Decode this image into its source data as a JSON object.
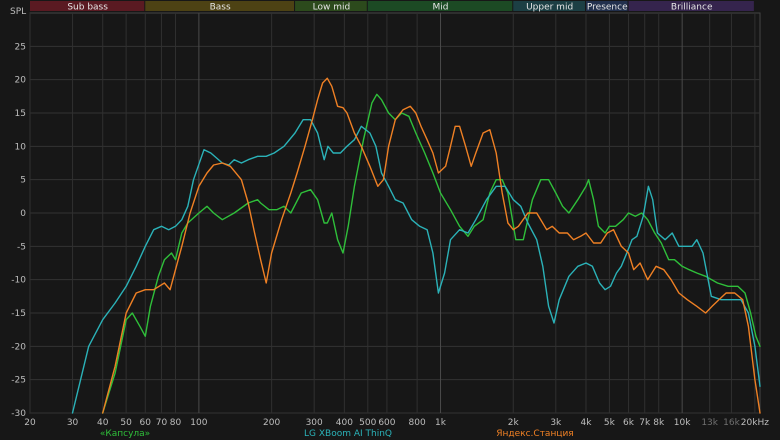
{
  "chart_data": {
    "type": "line",
    "ylabel": "SPL",
    "x_scale": "log",
    "xlim": [
      20,
      21000
    ],
    "ylim": [
      -30,
      30
    ],
    "grid": true,
    "y_ticks": [
      25,
      20,
      15,
      10,
      5,
      0,
      -5,
      -10,
      -15,
      -20,
      -25,
      -30
    ],
    "x_ticks": [
      {
        "f": 20,
        "label": "20"
      },
      {
        "f": 30,
        "label": "30"
      },
      {
        "f": 40,
        "label": "40"
      },
      {
        "f": 50,
        "label": "50"
      },
      {
        "f": 60,
        "label": "60"
      },
      {
        "f": 70,
        "label": "70"
      },
      {
        "f": 80,
        "label": "80"
      },
      {
        "f": 100,
        "label": "100"
      },
      {
        "f": 200,
        "label": "200"
      },
      {
        "f": 300,
        "label": "300"
      },
      {
        "f": 400,
        "label": "400"
      },
      {
        "f": 500,
        "label": "500"
      },
      {
        "f": 600,
        "label": "600"
      },
      {
        "f": 800,
        "label": "800"
      },
      {
        "f": 1000,
        "label": "1k"
      },
      {
        "f": 2000,
        "label": "2k"
      },
      {
        "f": 3000,
        "label": "3k"
      },
      {
        "f": 4000,
        "label": "4k"
      },
      {
        "f": 5000,
        "label": "5k"
      },
      {
        "f": 6000,
        "label": "6k"
      },
      {
        "f": 7000,
        "label": "7k"
      },
      {
        "f": 8000,
        "label": "8k"
      },
      {
        "f": 10000,
        "label": "10k"
      },
      {
        "f": 13000,
        "label": "13k",
        "dim": true
      },
      {
        "f": 16000,
        "label": "16k",
        "dim": true
      },
      {
        "f": 20000,
        "label": "20kHz"
      }
    ],
    "bands": [
      {
        "name": "Sub bass",
        "from": 20,
        "to": 60,
        "color": "#5a1a22",
        "text": "#f0c8c8"
      },
      {
        "name": "Bass",
        "from": 60,
        "to": 250,
        "color": "#4d4214",
        "text": "#f0e4a8"
      },
      {
        "name": "Low mid",
        "from": 250,
        "to": 500,
        "color": "#2c4a1c",
        "text": "#d4f0c0"
      },
      {
        "name": "Mid",
        "from": 500,
        "to": 2000,
        "color": "#1c4a24",
        "text": "#c8f0cc"
      },
      {
        "name": "Upper mid",
        "from": 2000,
        "to": 4000,
        "color": "#1c3f44",
        "text": "#c4ecf0"
      },
      {
        "name": "Presence",
        "from": 4000,
        "to": 6000,
        "color": "#22304d",
        "text": "#cad6f4"
      },
      {
        "name": "Brilliance",
        "from": 6000,
        "to": 20000,
        "color": "#35244d",
        "text": "#dccaf4"
      }
    ],
    "series": [
      {
        "name": "«Капсула»",
        "color": "#2fbf3a",
        "points": [
          [
            40,
            -30
          ],
          [
            45,
            -24
          ],
          [
            50,
            -16
          ],
          [
            53,
            -15
          ],
          [
            57,
            -17
          ],
          [
            60,
            -18.5
          ],
          [
            63,
            -14
          ],
          [
            68,
            -9.5
          ],
          [
            72,
            -7
          ],
          [
            77,
            -6
          ],
          [
            80,
            -7
          ],
          [
            85,
            -3
          ],
          [
            90,
            -1.5
          ],
          [
            100,
            0
          ],
          [
            108,
            1
          ],
          [
            115,
            0
          ],
          [
            125,
            -1
          ],
          [
            140,
            0
          ],
          [
            160,
            1.5
          ],
          [
            175,
            2
          ],
          [
            180,
            1.5
          ],
          [
            195,
            0.5
          ],
          [
            210,
            0.5
          ],
          [
            225,
            1
          ],
          [
            240,
            0
          ],
          [
            265,
            3
          ],
          [
            290,
            3.5
          ],
          [
            310,
            2
          ],
          [
            330,
            -1.5
          ],
          [
            340,
            -1.5
          ],
          [
            355,
            0
          ],
          [
            375,
            -4
          ],
          [
            395,
            -6
          ],
          [
            415,
            -2
          ],
          [
            440,
            4
          ],
          [
            480,
            11
          ],
          [
            520,
            16.5
          ],
          [
            545,
            17.8
          ],
          [
            570,
            17
          ],
          [
            610,
            15
          ],
          [
            650,
            14
          ],
          [
            690,
            15
          ],
          [
            740,
            14.5
          ],
          [
            790,
            12
          ],
          [
            860,
            9
          ],
          [
            930,
            6
          ],
          [
            1000,
            3
          ],
          [
            1100,
            0.5
          ],
          [
            1200,
            -2
          ],
          [
            1300,
            -3.5
          ],
          [
            1380,
            -2
          ],
          [
            1500,
            -1
          ],
          [
            1600,
            3
          ],
          [
            1700,
            5
          ],
          [
            1800,
            5
          ],
          [
            1900,
            3
          ],
          [
            2050,
            -4
          ],
          [
            2200,
            -4
          ],
          [
            2400,
            2
          ],
          [
            2600,
            5
          ],
          [
            2800,
            5
          ],
          [
            3000,
            3
          ],
          [
            3200,
            1
          ],
          [
            3400,
            0
          ],
          [
            3700,
            2
          ],
          [
            4000,
            4
          ],
          [
            4100,
            5
          ],
          [
            4300,
            2
          ],
          [
            4500,
            -2
          ],
          [
            4800,
            -3
          ],
          [
            5000,
            -2
          ],
          [
            5300,
            -2
          ],
          [
            5700,
            -1
          ],
          [
            6000,
            0
          ],
          [
            6400,
            -0.5
          ],
          [
            6800,
            0
          ],
          [
            7200,
            -1
          ],
          [
            7700,
            -3
          ],
          [
            8200,
            -4.5
          ],
          [
            8800,
            -7
          ],
          [
            9300,
            -7
          ],
          [
            10000,
            -8
          ],
          [
            10700,
            -8.5
          ],
          [
            11500,
            -9
          ],
          [
            12500,
            -9.5
          ],
          [
            14000,
            -10.5
          ],
          [
            15500,
            -11
          ],
          [
            17000,
            -11
          ],
          [
            18200,
            -12
          ],
          [
            19200,
            -15
          ],
          [
            20200,
            -18.5
          ],
          [
            21000,
            -20
          ]
        ]
      },
      {
        "name": "LG XBoom AI ThinQ",
        "color": "#2bb2b8",
        "points": [
          [
            30,
            -30
          ],
          [
            35,
            -20
          ],
          [
            40,
            -16
          ],
          [
            45,
            -13.5
          ],
          [
            50,
            -11
          ],
          [
            55,
            -8
          ],
          [
            60,
            -5
          ],
          [
            65,
            -2.5
          ],
          [
            70,
            -2
          ],
          [
            75,
            -2.5
          ],
          [
            80,
            -2
          ],
          [
            85,
            -1
          ],
          [
            90,
            1
          ],
          [
            95,
            5
          ],
          [
            105,
            9.5
          ],
          [
            112,
            9
          ],
          [
            125,
            7.5
          ],
          [
            133,
            7.2
          ],
          [
            140,
            8
          ],
          [
            150,
            7.5
          ],
          [
            160,
            8
          ],
          [
            175,
            8.5
          ],
          [
            190,
            8.5
          ],
          [
            205,
            9
          ],
          [
            225,
            10
          ],
          [
            250,
            12
          ],
          [
            270,
            14
          ],
          [
            290,
            14
          ],
          [
            310,
            12
          ],
          [
            330,
            8
          ],
          [
            342,
            10
          ],
          [
            360,
            9
          ],
          [
            385,
            9
          ],
          [
            410,
            10
          ],
          [
            440,
            11
          ],
          [
            470,
            13
          ],
          [
            510,
            12
          ],
          [
            540,
            10
          ],
          [
            570,
            6
          ],
          [
            610,
            4
          ],
          [
            650,
            2
          ],
          [
            700,
            1.5
          ],
          [
            760,
            -1
          ],
          [
            820,
            -2
          ],
          [
            880,
            -2.5
          ],
          [
            930,
            -6
          ],
          [
            980,
            -12
          ],
          [
            1040,
            -9
          ],
          [
            1100,
            -4
          ],
          [
            1200,
            -2.5
          ],
          [
            1300,
            -3
          ],
          [
            1400,
            -1
          ],
          [
            1550,
            2
          ],
          [
            1700,
            4
          ],
          [
            1850,
            4
          ],
          [
            2000,
            2
          ],
          [
            2150,
            1
          ],
          [
            2300,
            -1.5
          ],
          [
            2500,
            -4
          ],
          [
            2650,
            -8
          ],
          [
            2800,
            -14
          ],
          [
            2950,
            -16.5
          ],
          [
            3100,
            -13
          ],
          [
            3400,
            -9.5
          ],
          [
            3700,
            -8
          ],
          [
            4000,
            -7.5
          ],
          [
            4250,
            -8
          ],
          [
            4550,
            -10.5
          ],
          [
            4800,
            -11.5
          ],
          [
            5050,
            -11
          ],
          [
            5350,
            -9
          ],
          [
            5600,
            -8
          ],
          [
            5900,
            -6
          ],
          [
            6200,
            -4
          ],
          [
            6500,
            -3.5
          ],
          [
            6900,
            -0.5
          ],
          [
            7250,
            4
          ],
          [
            7550,
            2
          ],
          [
            7900,
            -3
          ],
          [
            8500,
            -4
          ],
          [
            9100,
            -3
          ],
          [
            9700,
            -5
          ],
          [
            10300,
            -5
          ],
          [
            11000,
            -5
          ],
          [
            11500,
            -4
          ],
          [
            12200,
            -6
          ],
          [
            13200,
            -12.5
          ],
          [
            14500,
            -13
          ],
          [
            16000,
            -13
          ],
          [
            17500,
            -13
          ],
          [
            18800,
            -15
          ],
          [
            20000,
            -20
          ],
          [
            21000,
            -26
          ]
        ]
      },
      {
        "name": "Яндекс.Станция",
        "color": "#ef8024",
        "points": [
          [
            40,
            -30
          ],
          [
            45,
            -23
          ],
          [
            50,
            -15
          ],
          [
            55,
            -12
          ],
          [
            60,
            -11.5
          ],
          [
            65,
            -11.5
          ],
          [
            72,
            -10.5
          ],
          [
            76,
            -11.5
          ],
          [
            85,
            -5
          ],
          [
            92,
            0
          ],
          [
            100,
            4
          ],
          [
            108,
            6
          ],
          [
            115,
            7.2
          ],
          [
            125,
            7.5
          ],
          [
            135,
            7
          ],
          [
            150,
            5
          ],
          [
            160,
            1.5
          ],
          [
            170,
            -3
          ],
          [
            180,
            -7
          ],
          [
            190,
            -10.5
          ],
          [
            200,
            -6
          ],
          [
            220,
            -1
          ],
          [
            240,
            3
          ],
          [
            255,
            6
          ],
          [
            275,
            10
          ],
          [
            295,
            14
          ],
          [
            310,
            17
          ],
          [
            325,
            19.5
          ],
          [
            340,
            20.2
          ],
          [
            355,
            19
          ],
          [
            375,
            16
          ],
          [
            395,
            15.8
          ],
          [
            410,
            15
          ],
          [
            440,
            12
          ],
          [
            470,
            10
          ],
          [
            510,
            7
          ],
          [
            550,
            4
          ],
          [
            580,
            5
          ],
          [
            610,
            10
          ],
          [
            650,
            14
          ],
          [
            700,
            15.5
          ],
          [
            750,
            16
          ],
          [
            790,
            15
          ],
          [
            830,
            13
          ],
          [
            880,
            11
          ],
          [
            930,
            9
          ],
          [
            980,
            6
          ],
          [
            1050,
            7
          ],
          [
            1100,
            10
          ],
          [
            1150,
            13
          ],
          [
            1200,
            13
          ],
          [
            1270,
            10
          ],
          [
            1340,
            7
          ],
          [
            1400,
            9
          ],
          [
            1500,
            12
          ],
          [
            1600,
            12.5
          ],
          [
            1700,
            9
          ],
          [
            1800,
            3
          ],
          [
            1900,
            -1.5
          ],
          [
            2000,
            -2.5
          ],
          [
            2100,
            -2
          ],
          [
            2300,
            0
          ],
          [
            2500,
            0
          ],
          [
            2750,
            -2.5
          ],
          [
            2900,
            -2
          ],
          [
            3100,
            -3
          ],
          [
            3350,
            -3
          ],
          [
            3550,
            -4
          ],
          [
            3800,
            -3.5
          ],
          [
            4000,
            -3
          ],
          [
            4300,
            -4.5
          ],
          [
            4600,
            -4.5
          ],
          [
            4900,
            -3
          ],
          [
            5200,
            -2.5
          ],
          [
            5600,
            -5
          ],
          [
            6000,
            -6
          ],
          [
            6300,
            -8.5
          ],
          [
            6700,
            -7.5
          ],
          [
            7200,
            -10
          ],
          [
            7800,
            -8
          ],
          [
            8400,
            -8.5
          ],
          [
            9000,
            -10
          ],
          [
            9700,
            -12
          ],
          [
            10500,
            -13
          ],
          [
            11500,
            -14
          ],
          [
            12500,
            -15
          ],
          [
            13300,
            -14
          ],
          [
            14200,
            -13
          ],
          [
            15200,
            -12
          ],
          [
            16500,
            -12
          ],
          [
            17800,
            -13
          ],
          [
            18800,
            -17
          ],
          [
            20000,
            -25
          ],
          [
            21000,
            -30
          ]
        ]
      }
    ]
  }
}
